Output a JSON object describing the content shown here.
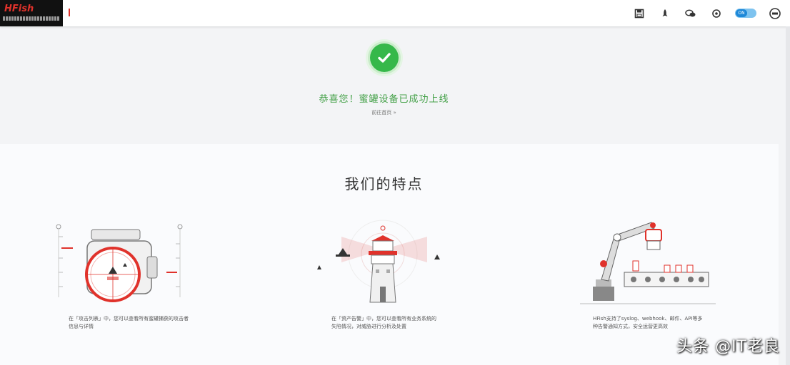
{
  "app": {
    "logo_text": "HFish",
    "logo_subtitle": "蜜罐安全"
  },
  "toolbar": {
    "icons": [
      "save-icon",
      "rocket-icon",
      "chat-icon",
      "settings-icon",
      "toggle-switch",
      "user-icon"
    ],
    "toggle_label": "ON"
  },
  "success": {
    "title": "恭喜您！蜜罐设备已成功上线",
    "link": "前往首页 »"
  },
  "features": {
    "heading": "我们的特点",
    "items": [
      {
        "text": "在「攻击列表」中，您可以查看所有蜜罐捕获的攻击者信息与详情",
        "icon": "radar-scope-icon"
      },
      {
        "text": "在「资产告警」中，您可以查看所有业务系统的失陷情况，对威胁进行分析及处置",
        "icon": "watchtower-icon"
      },
      {
        "text": "HFish支持了syslog、webhook、邮件、API等多种告警通知方式，安全运营更高效",
        "icon": "robot-arm-icon"
      }
    ]
  },
  "watermark": "头条 @IT老良",
  "colors": {
    "success": "#36b84a",
    "accent": "#e0322b",
    "toggle": "#1e88d8"
  }
}
